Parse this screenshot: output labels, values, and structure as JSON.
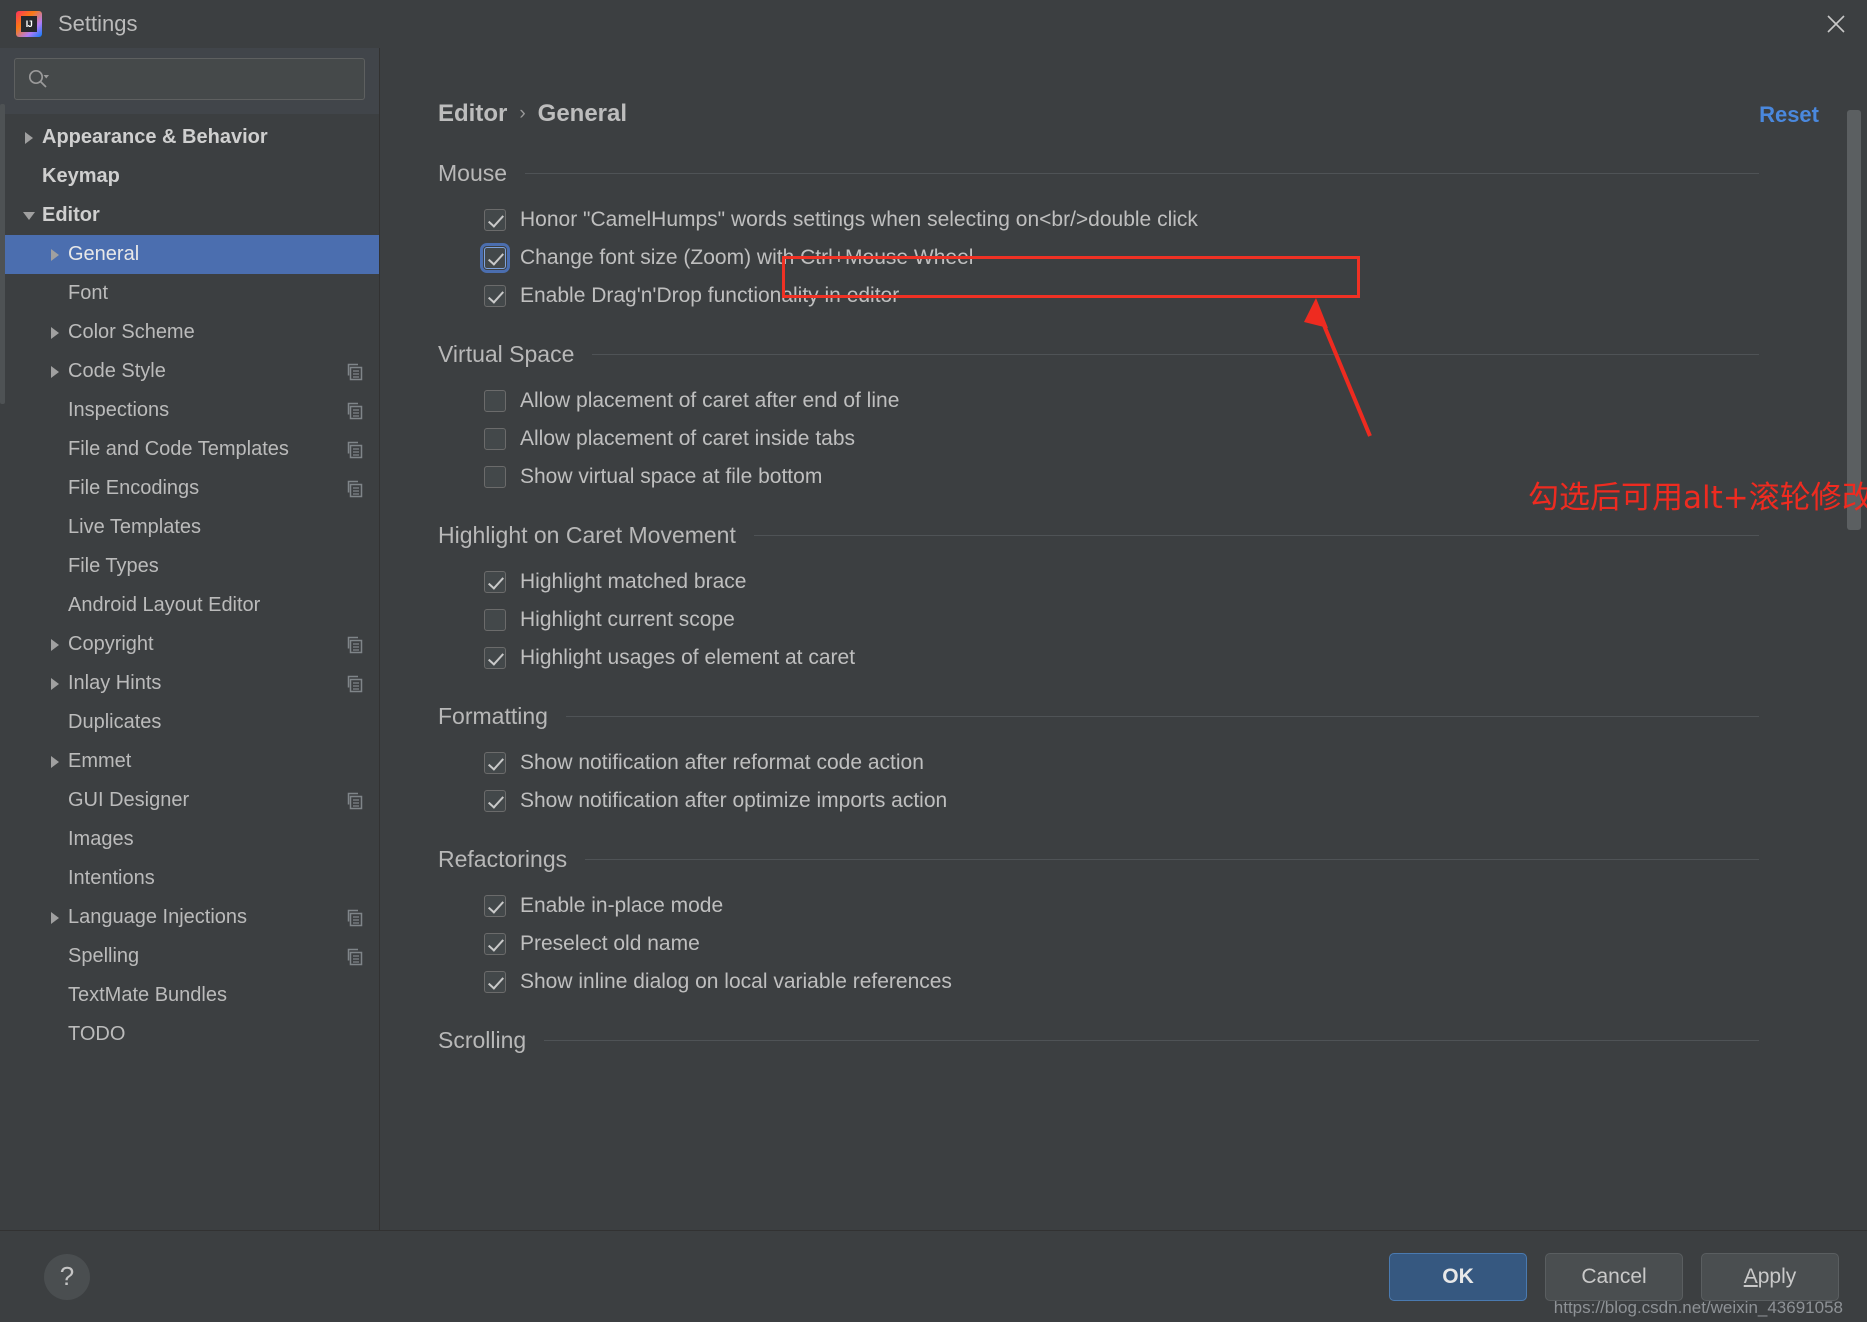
{
  "window": {
    "title": "Settings",
    "logo_icon": "intellij-idea-logo",
    "close_icon": "close-icon"
  },
  "search": {
    "placeholder": "",
    "value": "",
    "icon": "search-icon"
  },
  "sidebar": {
    "scroll_icon": "vertical-scrollbar",
    "items": [
      {
        "label": "Appearance & Behavior",
        "level": 0,
        "arrow": "collapsed",
        "selected": false,
        "copy": false
      },
      {
        "label": "Keymap",
        "level": 0,
        "arrow": "none",
        "selected": false,
        "copy": false
      },
      {
        "label": "Editor",
        "level": 0,
        "arrow": "expanded",
        "selected": false,
        "copy": false
      },
      {
        "label": "General",
        "level": 1,
        "arrow": "collapsed",
        "selected": true,
        "copy": false
      },
      {
        "label": "Font",
        "level": 1,
        "arrow": "none",
        "selected": false,
        "copy": false
      },
      {
        "label": "Color Scheme",
        "level": 1,
        "arrow": "collapsed",
        "selected": false,
        "copy": false
      },
      {
        "label": "Code Style",
        "level": 1,
        "arrow": "collapsed",
        "selected": false,
        "copy": true
      },
      {
        "label": "Inspections",
        "level": 1,
        "arrow": "none",
        "selected": false,
        "copy": true
      },
      {
        "label": "File and Code Templates",
        "level": 1,
        "arrow": "none",
        "selected": false,
        "copy": true
      },
      {
        "label": "File Encodings",
        "level": 1,
        "arrow": "none",
        "selected": false,
        "copy": true
      },
      {
        "label": "Live Templates",
        "level": 1,
        "arrow": "none",
        "selected": false,
        "copy": false
      },
      {
        "label": "File Types",
        "level": 1,
        "arrow": "none",
        "selected": false,
        "copy": false
      },
      {
        "label": "Android Layout Editor",
        "level": 1,
        "arrow": "none",
        "selected": false,
        "copy": false
      },
      {
        "label": "Copyright",
        "level": 1,
        "arrow": "collapsed",
        "selected": false,
        "copy": true
      },
      {
        "label": "Inlay Hints",
        "level": 1,
        "arrow": "collapsed",
        "selected": false,
        "copy": true
      },
      {
        "label": "Duplicates",
        "level": 1,
        "arrow": "none",
        "selected": false,
        "copy": false
      },
      {
        "label": "Emmet",
        "level": 1,
        "arrow": "collapsed",
        "selected": false,
        "copy": false
      },
      {
        "label": "GUI Designer",
        "level": 1,
        "arrow": "none",
        "selected": false,
        "copy": true
      },
      {
        "label": "Images",
        "level": 1,
        "arrow": "none",
        "selected": false,
        "copy": false
      },
      {
        "label": "Intentions",
        "level": 1,
        "arrow": "none",
        "selected": false,
        "copy": false
      },
      {
        "label": "Language Injections",
        "level": 1,
        "arrow": "collapsed",
        "selected": false,
        "copy": true
      },
      {
        "label": "Spelling",
        "level": 1,
        "arrow": "none",
        "selected": false,
        "copy": true
      },
      {
        "label": "TextMate Bundles",
        "level": 1,
        "arrow": "none",
        "selected": false,
        "copy": false
      },
      {
        "label": "TODO",
        "level": 1,
        "arrow": "none",
        "selected": false,
        "copy": false
      }
    ]
  },
  "main": {
    "breadcrumb": {
      "root": "Editor",
      "separator": "›",
      "leaf": "General"
    },
    "reset_label": "Reset",
    "sections": [
      {
        "title": "Mouse",
        "options": [
          {
            "label": "Honor \"CamelHumps\" words settings when selecting on<br/>double click",
            "checked": true,
            "focused": false
          },
          {
            "label": "Change font size (Zoom) with Ctrl+Mouse Wheel",
            "checked": true,
            "focused": true
          },
          {
            "label": "Enable Drag'n'Drop functionality in editor",
            "checked": true,
            "focused": false
          }
        ]
      },
      {
        "title": "Virtual Space",
        "options": [
          {
            "label": "Allow placement of caret after end of line",
            "checked": false,
            "focused": false
          },
          {
            "label": "Allow placement of caret inside tabs",
            "checked": false,
            "focused": false
          },
          {
            "label": "Show virtual space at file bottom",
            "checked": false,
            "focused": false
          }
        ]
      },
      {
        "title": "Highlight on Caret Movement",
        "options": [
          {
            "label": "Highlight matched brace",
            "checked": true,
            "focused": false
          },
          {
            "label": "Highlight current scope",
            "checked": false,
            "focused": false
          },
          {
            "label": "Highlight usages of element at caret",
            "checked": true,
            "focused": false
          }
        ]
      },
      {
        "title": "Formatting",
        "options": [
          {
            "label": "Show notification after reformat code action",
            "checked": true,
            "focused": false
          },
          {
            "label": "Show notification after optimize imports action",
            "checked": true,
            "focused": false
          }
        ]
      },
      {
        "title": "Refactorings",
        "options": [
          {
            "label": "Enable in-place mode",
            "checked": true,
            "focused": false
          },
          {
            "label": "Preselect old name",
            "checked": true,
            "focused": false
          },
          {
            "label": "Show inline dialog on local variable references",
            "checked": true,
            "focused": false
          }
        ]
      },
      {
        "title": "Scrolling",
        "options": []
      }
    ]
  },
  "annotation": {
    "note_text": "勾选后可用alt+滚轮修改代码字体大小",
    "note_color": "#ee2b20",
    "highlight_color": "#ef3124",
    "arrow_icon": "red-arrow-pointer"
  },
  "footer": {
    "help_label": "?",
    "ok_label": "OK",
    "cancel_label": "Cancel",
    "apply_label_prefix": "A",
    "apply_label_rest": "pply",
    "watermark": "https://blog.csdn.net/weixin_43691058"
  },
  "colors": {
    "accent": "#4b6eaf",
    "link": "#4a88dd",
    "background": "#3c3f41",
    "text": "#bbbbbb",
    "primary_button": "#365880"
  }
}
